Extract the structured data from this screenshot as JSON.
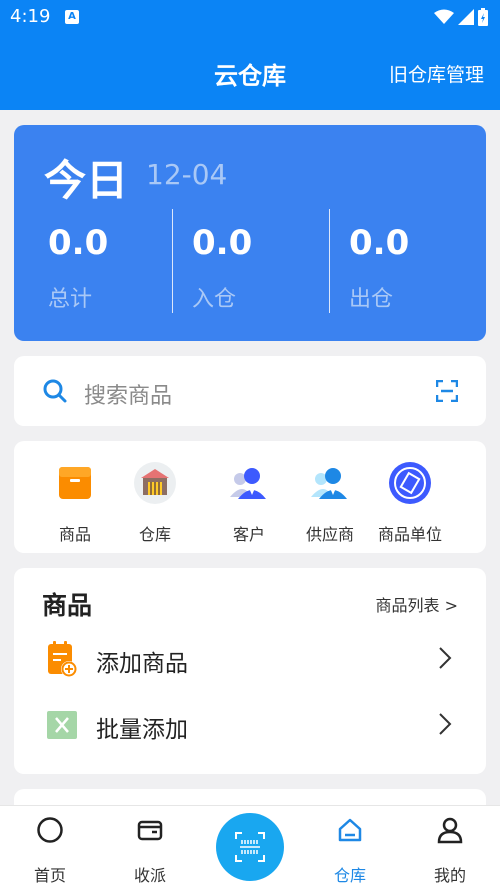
{
  "statusbar": {
    "time": "4:19",
    "notif_badge": "A"
  },
  "appbar": {
    "title": "云仓库",
    "right_link": "旧仓库管理"
  },
  "today": {
    "title": "今日",
    "date": "12-04",
    "stats": [
      {
        "value": "0.0",
        "label": "总计"
      },
      {
        "value": "0.0",
        "label": "入仓"
      },
      {
        "value": "0.0",
        "label": "出仓"
      }
    ]
  },
  "search": {
    "placeholder": "搜索商品"
  },
  "categories": [
    {
      "label": "商品",
      "icon": "box-icon"
    },
    {
      "label": "仓库",
      "icon": "warehouse-icon"
    },
    {
      "label": "客户",
      "icon": "customer-icon"
    },
    {
      "label": "供应商",
      "icon": "supplier-icon"
    },
    {
      "label": "商品单位",
      "icon": "unit-icon"
    }
  ],
  "goods": {
    "heading": "商品",
    "more_link": "商品列表 >",
    "rows": [
      {
        "label": "添加商品",
        "icon": "add-goods-icon"
      },
      {
        "label": "批量添加",
        "icon": "excel-icon"
      }
    ]
  },
  "tabbar": {
    "tabs": [
      {
        "label": "首页",
        "icon": "home-circle-icon"
      },
      {
        "label": "收派",
        "icon": "wallet-icon"
      },
      {
        "label": "仓库",
        "icon": "warehouse-house-icon",
        "active": true
      },
      {
        "label": "我的",
        "icon": "person-icon"
      }
    ]
  },
  "colors": {
    "primary": "#0b84f5",
    "card_blue": "#3b82f0",
    "fab": "#19a7f0",
    "active_tab": "#1e88e5"
  }
}
